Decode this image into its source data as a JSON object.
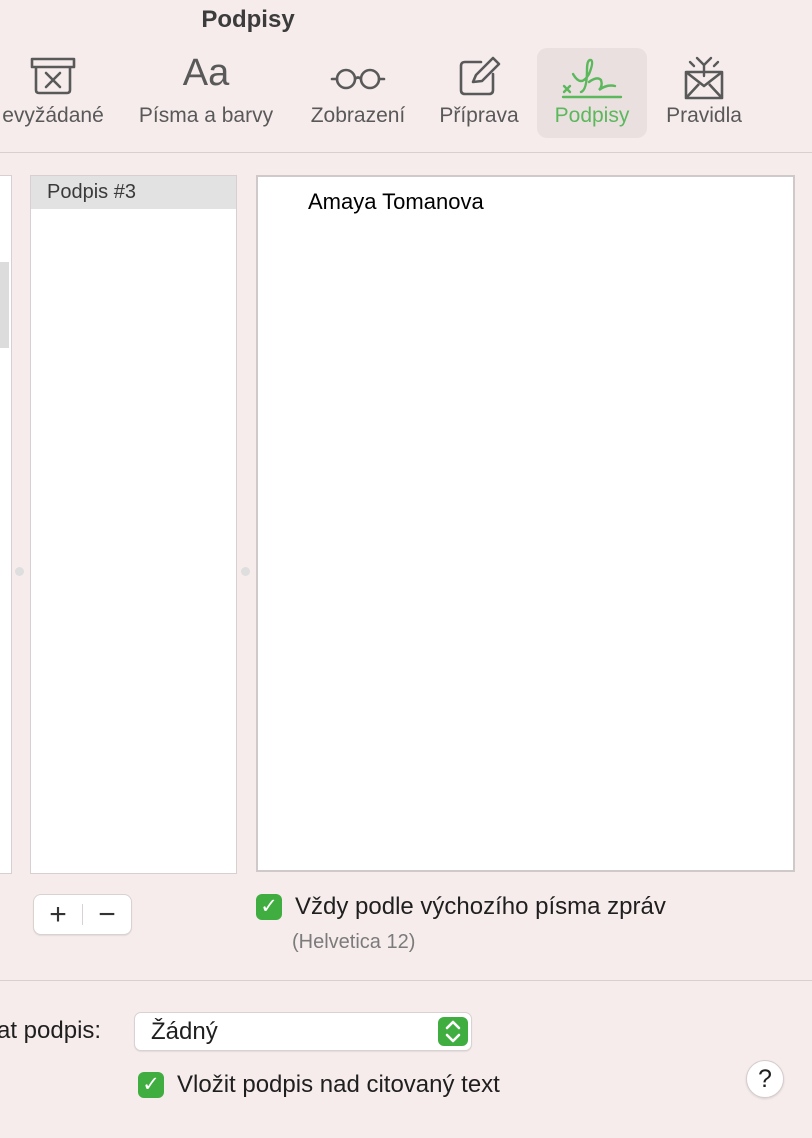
{
  "window": {
    "title": "Podpisy"
  },
  "toolbar": {
    "items": [
      {
        "label": "evyžádané",
        "icon": "junk-box-icon"
      },
      {
        "label": "Písma a barvy",
        "icon": "fonts-aa-icon"
      },
      {
        "label": "Zobrazení",
        "icon": "glasses-icon"
      },
      {
        "label": "Příprava",
        "icon": "compose-icon"
      },
      {
        "label": "Podpisy",
        "icon": "signature-icon",
        "active": true
      },
      {
        "label": "Pravidla",
        "icon": "rules-envelope-icon"
      }
    ],
    "fonts_glyph": "Aa"
  },
  "signatures": {
    "list": [
      {
        "label": "Podpis #3",
        "selected": true
      }
    ],
    "editor_text": "Amaya Tomanova",
    "add_glyph": "+",
    "remove_glyph": "−"
  },
  "options": {
    "default_font_checkbox": {
      "label": "Vždy podle výchozího písma zpráv",
      "checked": true,
      "sub": "(Helvetica 12)"
    },
    "choose_signature_label": "at podpis:",
    "choose_signature_value": "Žádný",
    "place_above_checkbox": {
      "label": "Vložit podpis nad citovaný text",
      "checked": true
    }
  },
  "help": {
    "glyph": "?"
  },
  "colors": {
    "accent": "#3fad3f",
    "active_label": "#5cb85c",
    "background": "#f6ecec"
  }
}
